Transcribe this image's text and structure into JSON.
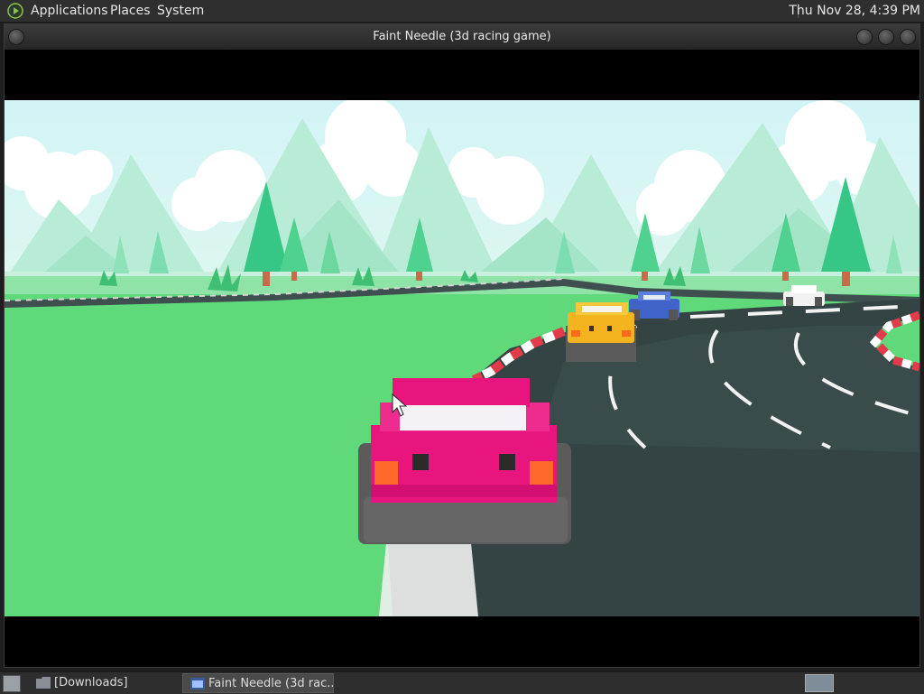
{
  "top_panel": {
    "menus": [
      "Applications",
      "Places",
      "System"
    ],
    "clock": "Thu Nov 28,  4:39 PM"
  },
  "window": {
    "title": "Faint Needle (3d racing game)"
  },
  "taskbar": {
    "tasks": [
      "[Downloads]",
      "Faint Needle (3d rac..."
    ]
  },
  "colors": {
    "sky": "#d8f5f5",
    "grass": "#5fd97a",
    "track": "#3b4a4a",
    "player_car": "#e8157f",
    "car_yellow": "#f3b41f",
    "car_blue": "#3f63c9",
    "car_white": "#f2f2f2",
    "panel": "#2f2f2f"
  },
  "icons": {
    "app_logo": "play-logo-icon",
    "folder": "folder-icon",
    "game_window": "game-window-icon"
  }
}
